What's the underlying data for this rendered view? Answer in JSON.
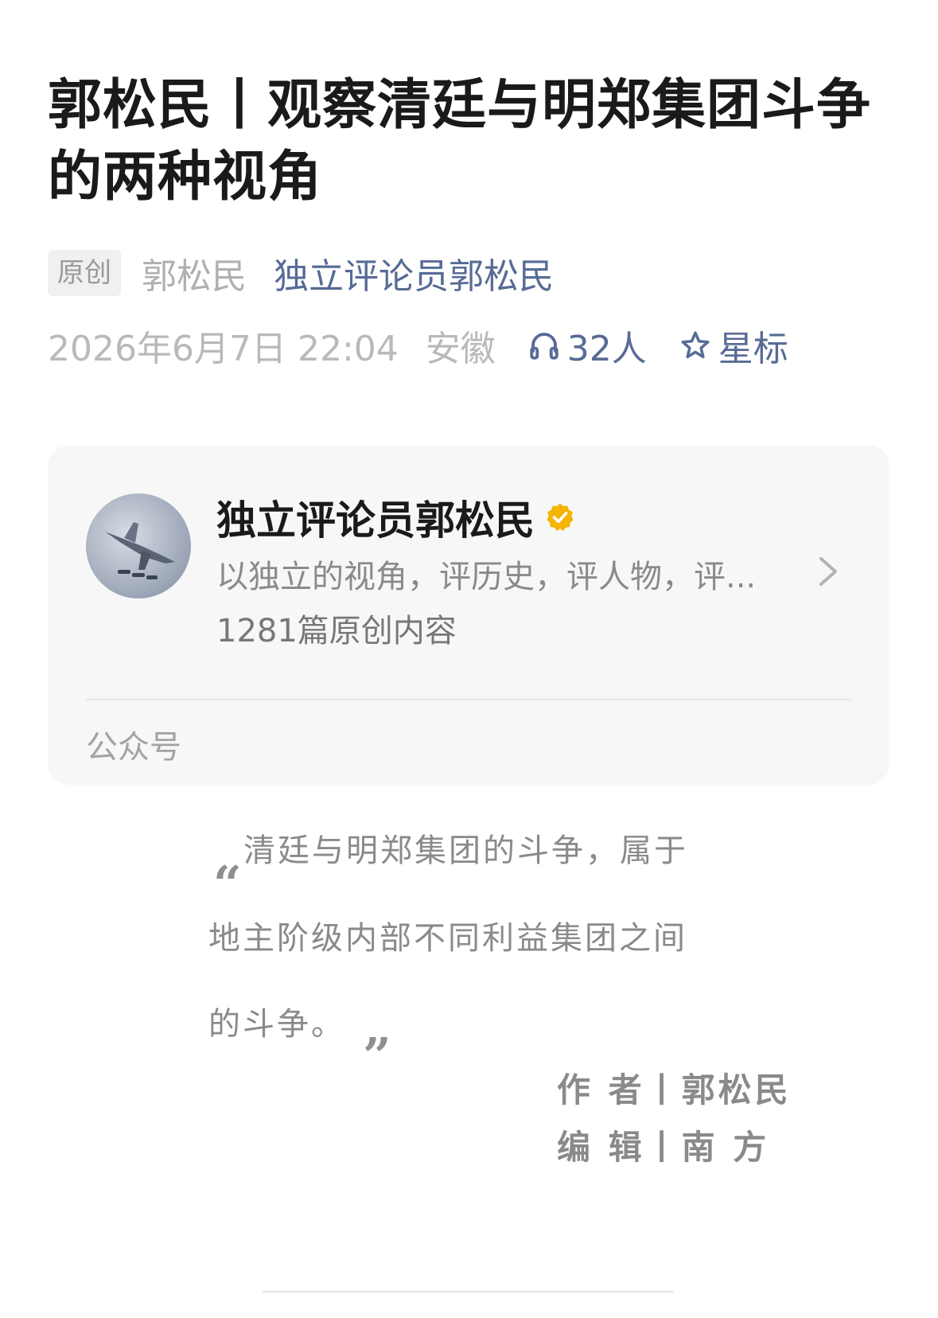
{
  "article": {
    "title": "郭松民丨观察清廷与明郑集团斗争的两种视角",
    "original_badge": "原创",
    "author": "郭松民",
    "account_name": "独立评论员郭松民",
    "date": "2026年6月7日 22:04",
    "region": "安徽",
    "listeners": "32人",
    "star_label": "星标"
  },
  "account_card": {
    "name": "独立评论员郭松民",
    "description": "以独立的视角，评历史，评人物，评...",
    "count": "1281篇原创内容",
    "type": "公众号"
  },
  "quote": {
    "line1": "清廷与明郑集团的斗争，属于",
    "line2": "地主阶级内部不同利益集团之间",
    "line3": "的斗争。",
    "open_mark": "“",
    "close_mark": "”"
  },
  "credits": {
    "author_line": "作 者丨郭松民",
    "editor_line": "编 辑丨南  方"
  },
  "colors": {
    "link": "#576b95",
    "verified": "#f5b400"
  },
  "icons": [
    "headphones-icon",
    "star-icon",
    "verified-icon",
    "chevron-right-icon"
  ]
}
